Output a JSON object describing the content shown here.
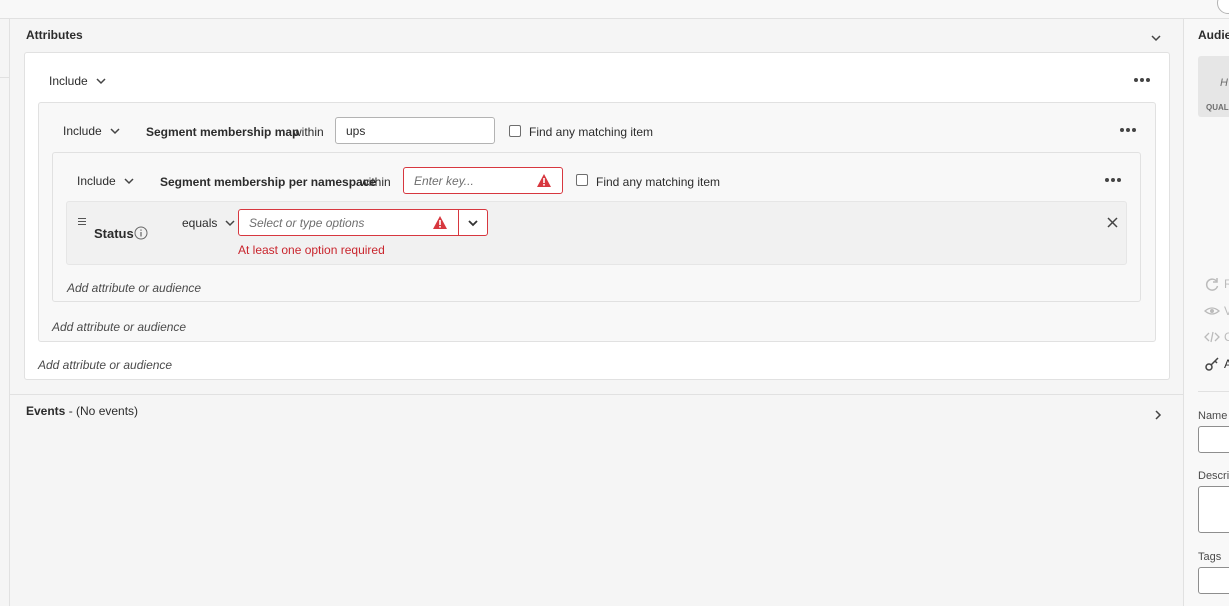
{
  "attributes_section": {
    "title": "Attributes",
    "outer_rule": {
      "include_label": "Include",
      "add_link": "Add attribute or audience"
    },
    "rule_1": {
      "include_label": "Include",
      "attribute": "Segment membership map",
      "within_label": "within",
      "key_value": "ups",
      "find_any_label": "Find any matching item",
      "add_link": "Add attribute or audience"
    },
    "rule_2": {
      "include_label": "Include",
      "attribute": "Segment membership per namespace",
      "within_label": "within",
      "key_placeholder": "Enter key...",
      "find_any_label": "Find any matching item",
      "add_link": "Add attribute or audience"
    },
    "condition": {
      "field": "Status",
      "operator": "equals",
      "value_placeholder": "Select or type options",
      "error": "At least one option required"
    }
  },
  "events_section": {
    "title": "Events",
    "subtitle": " - (No events)"
  },
  "right_panel": {
    "title": "Audien",
    "card_text": "H",
    "card_caption": "QUAL",
    "action_1": "R",
    "action_2": "V",
    "action_3": "C",
    "action_4": "A",
    "name_label": "Name *",
    "description_label": "Descript",
    "tags_label": "Tags"
  },
  "colors": {
    "error": "#d7373f",
    "error_text": "#c9252d",
    "background": "#f5f5f5",
    "card": "#ffffff"
  }
}
